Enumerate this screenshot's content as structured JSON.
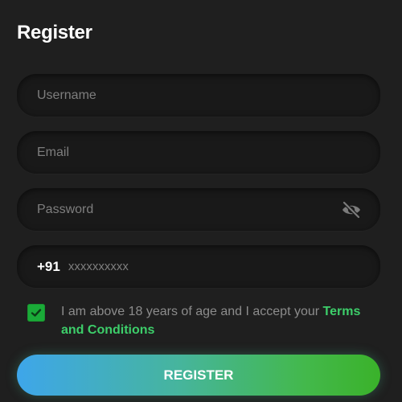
{
  "header": {
    "title": "Register"
  },
  "form": {
    "username": {
      "placeholder": "Username",
      "value": ""
    },
    "email": {
      "placeholder": "Email",
      "value": ""
    },
    "password": {
      "placeholder": "Password",
      "value": "",
      "visibility_icon": "eye-off-icon"
    },
    "phone": {
      "country_code": "+91",
      "placeholder": "xxxxxxxxxx",
      "value": ""
    },
    "terms": {
      "checked": true,
      "text": "I am above 18 years of age and I accept your ",
      "link_text": "Terms and Conditions"
    },
    "submit_label": "REGISTER"
  },
  "colors": {
    "background": "#1f1f1f",
    "field_background": "#191919",
    "accent_green": "#3dce6a",
    "checkbox_green": "#1aab38",
    "button_gradient_start": "#3ea6ea",
    "button_gradient_end": "#3ab22a"
  }
}
